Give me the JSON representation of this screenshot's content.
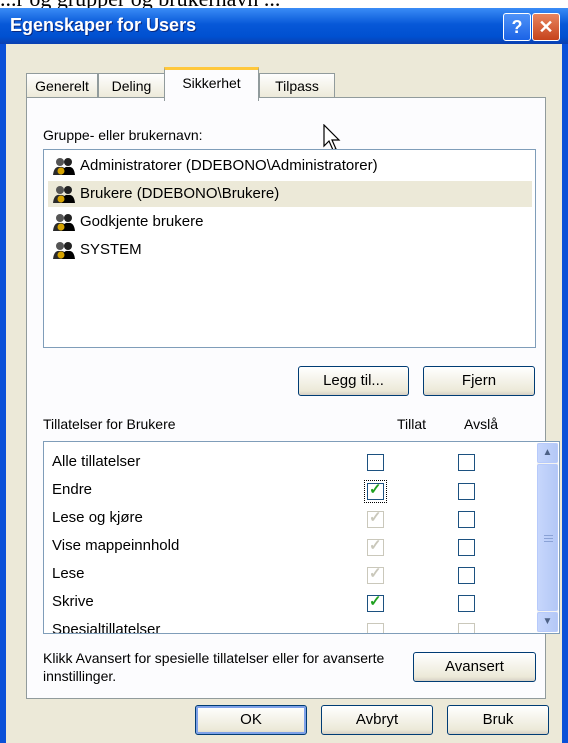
{
  "background_text": "...r og grupper og brukernavn ...",
  "window": {
    "title": "Egenskaper for Users",
    "help_label": "?",
    "close_label": "✕"
  },
  "tabs": [
    {
      "label": "Generelt"
    },
    {
      "label": "Deling"
    },
    {
      "label": "Sikkerhet",
      "active": true
    },
    {
      "label": "Tilpass"
    }
  ],
  "groups": {
    "label": "Gruppe- eller brukernavn:",
    "items": [
      {
        "name": "Administratorer (DDEBONO\\Administratorer)",
        "icon": "users-group-icon"
      },
      {
        "name": "Brukere (DDEBONO\\Brukere)",
        "icon": "users-group-icon",
        "selected": true
      },
      {
        "name": "Godkjente brukere",
        "icon": "users-group-icon"
      },
      {
        "name": "SYSTEM",
        "icon": "users-group-icon"
      }
    ],
    "add_button": "Legg til...",
    "remove_button": "Fjern"
  },
  "permissions": {
    "label": "Tillatelser for Brukere",
    "allow_header": "Tillat",
    "deny_header": "Avslå",
    "rows": [
      {
        "name": "Alle tillatelser",
        "allow": "unchecked",
        "deny": "unchecked"
      },
      {
        "name": "Endre",
        "allow": "checked",
        "deny": "unchecked",
        "focused": true
      },
      {
        "name": "Lese og kjøre",
        "allow": "checked-disabled",
        "deny": "unchecked"
      },
      {
        "name": "Vise mappeinnhold",
        "allow": "checked-disabled",
        "deny": "unchecked"
      },
      {
        "name": "Lese",
        "allow": "checked-disabled",
        "deny": "unchecked"
      },
      {
        "name": "Skrive",
        "allow": "checked",
        "deny": "unchecked"
      },
      {
        "name": "Spesialtillatelser",
        "allow": "disabled",
        "deny": "disabled"
      }
    ]
  },
  "advanced": {
    "text": "Klikk Avansert for spesielle tillatelser eller for avanserte innstillinger.",
    "button": "Avansert"
  },
  "footer": {
    "ok": "OK",
    "cancel": "Avbryt",
    "apply": "Bruk"
  },
  "colors": {
    "titlebar": "#0758d8",
    "dialog_face": "#ece9d8",
    "check_allowed": "#21a121",
    "active_tab_accent": "#ffc83c"
  }
}
